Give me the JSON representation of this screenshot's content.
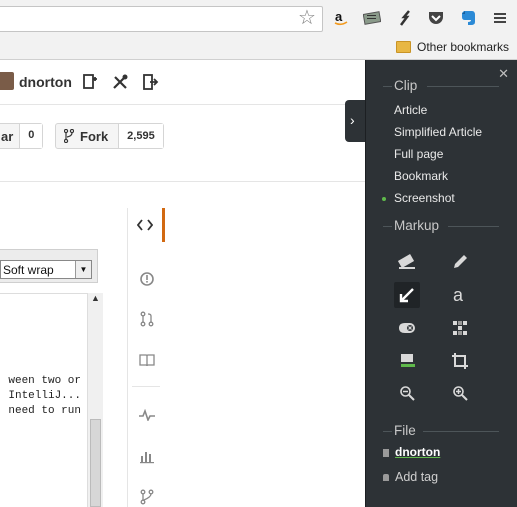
{
  "browser": {
    "bookmarks": {
      "folder_label": "Other bookmarks"
    },
    "extension_icons": [
      "amazon-icon",
      "reader-icon",
      "lastpass-icon",
      "pocket-icon",
      "evernote-icon",
      "menu-icon"
    ]
  },
  "github": {
    "header": {
      "username": "dnorton"
    },
    "star": {
      "label": "ar",
      "count": "0"
    },
    "fork": {
      "label": "Fork",
      "count": "2,595"
    },
    "editor": {
      "wrap_select": "Soft wrap",
      "code_lines": [
        "ween two or",
        " IntelliJ...",
        "need to run"
      ]
    }
  },
  "clipper": {
    "clip_heading": "Clip",
    "clip_options": [
      "Article",
      "Simplified Article",
      "Full page",
      "Bookmark",
      "Screenshot"
    ],
    "selected_option": "Screenshot",
    "markup_heading": "Markup",
    "file_heading": "File",
    "notebook": "dnorton",
    "add_tag": "Add tag",
    "accent_color": "#5fb94b"
  }
}
